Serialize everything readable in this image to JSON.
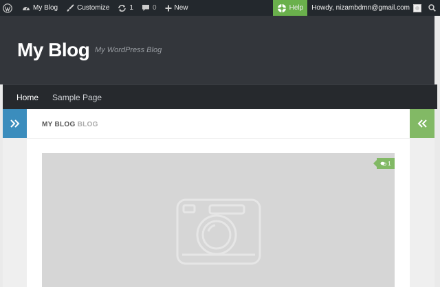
{
  "adminbar": {
    "site_name": "My Blog",
    "customize": "Customize",
    "updates_count": "1",
    "comments_count": "0",
    "new_label": "New",
    "help_label": "Help",
    "howdy": "Howdy, nizambdmn@gmail.com"
  },
  "header": {
    "title": "My Blog",
    "tagline": "My WordPress Blog"
  },
  "nav": {
    "items": [
      {
        "label": "Home"
      },
      {
        "label": "Sample Page"
      }
    ]
  },
  "content": {
    "heading_strong": "MY BLOG",
    "heading_light": "BLOG",
    "comment_count": "1"
  },
  "colors": {
    "adminbar_bg": "#23282d",
    "header_bg": "#33363b",
    "nav_bg": "#26292d",
    "accent_blue": "#3b8dbd",
    "accent_green": "#82b965",
    "help_green": "#6ab04c"
  },
  "icons": {
    "wp_logo": "wordpress-icon",
    "dashboard": "dashboard-icon",
    "customize": "paintbrush-icon",
    "updates": "refresh-icon",
    "comments": "comment-icon",
    "new": "plus-icon",
    "help": "lifebuoy-icon",
    "search": "search-icon",
    "sidebar_left": "double-chevron-right-icon",
    "sidebar_right": "double-chevron-left-icon",
    "placeholder": "camera-icon"
  }
}
